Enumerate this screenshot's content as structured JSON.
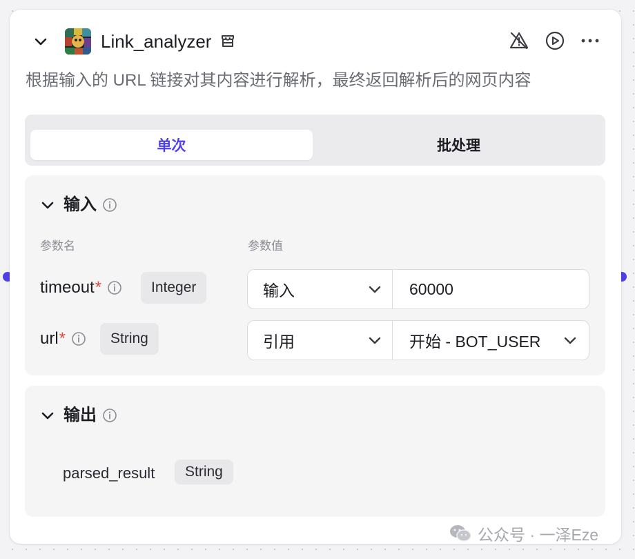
{
  "node": {
    "title": "Link_analyzer",
    "description": "根据输入的 URL 链接对其内容进行解析，最终返回解析后的网页内容",
    "icons": [
      "chevron-down-icon",
      "store-icon",
      "warning-off-icon",
      "play-icon",
      "more-icon"
    ]
  },
  "tabs": [
    {
      "label": "单次",
      "active": true
    },
    {
      "label": "批处理",
      "active": false
    }
  ],
  "input": {
    "heading": "输入",
    "col_name": "参数名",
    "col_value": "参数值",
    "params": [
      {
        "name": "timeout",
        "required_mark": "*",
        "type": "Integer",
        "mode": "输入",
        "value": "60000"
      },
      {
        "name": "url",
        "required_mark": "*",
        "type": "String",
        "mode": "引用",
        "value": "开始 - BOT_USER"
      }
    ]
  },
  "output": {
    "heading": "输出",
    "params": [
      {
        "name": "parsed_result",
        "type": "String"
      }
    ]
  },
  "watermark": "公众号 · 一泽Eze",
  "colors": {
    "accent": "#4e40e5",
    "required": "#e5483a"
  }
}
